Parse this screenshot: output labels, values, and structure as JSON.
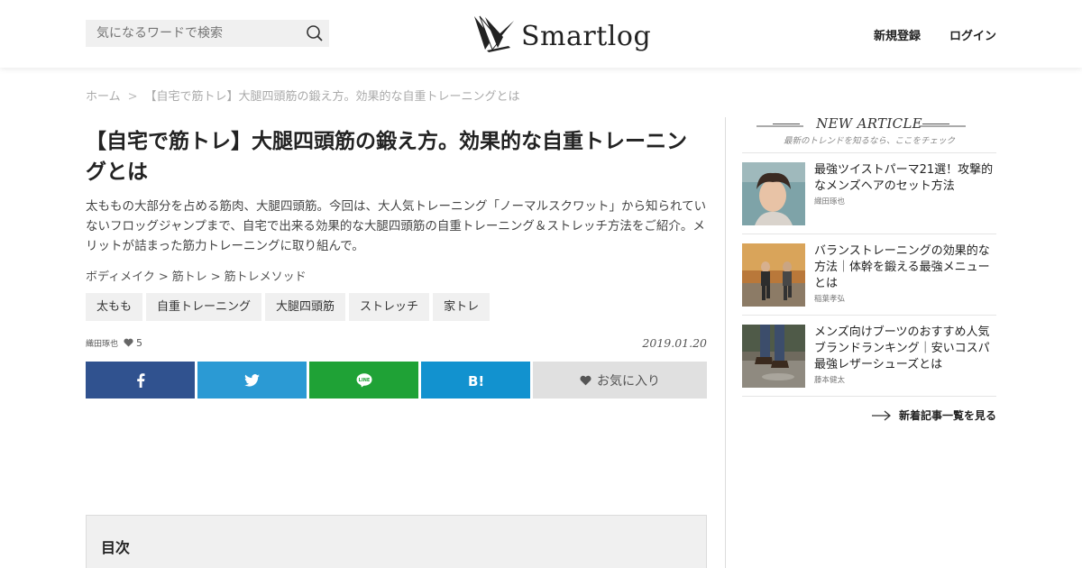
{
  "header": {
    "search_placeholder": "気になるワードで検索",
    "logo_text": "Smartlog",
    "signup_label": "新規登録",
    "login_label": "ログイン"
  },
  "breadcrumb": {
    "home": "ホーム",
    "separator": ">",
    "current": "【自宅で筋トレ】大腿四頭筋の鍛え方。効果的な自重トレーニングとは"
  },
  "article": {
    "title": "【自宅で筋トレ】大腿四頭筋の鍛え方。効果的な自重トレーニングとは",
    "lead": "太ももの大部分を占める筋肉、大腿四頭筋。今回は、大人気トレーニング「ノーマルスクワット」から知られていないフロッグジャンプまで、自宅で出来る効果的な大腿四頭筋の自重トレーニング＆ストレッチ方法をご紹介。メリットが詰まった筋力トレーニングに取り組んで。",
    "categories": [
      "ボディメイク",
      "筋トレ",
      "筋トレメソッド"
    ],
    "category_separator": ">",
    "tags": [
      "太もも",
      "自重トレーニング",
      "大腿四頭筋",
      "ストレッチ",
      "家トレ"
    ],
    "author": "織田琢也",
    "likes": "5",
    "date": "2019.01.20"
  },
  "share": {
    "favorite_label": "お気に入り"
  },
  "toc": {
    "title": "目次"
  },
  "sidebar": {
    "heading": "NEW ARTICLE",
    "subheading": "最新のトレンドを知るなら、ここをチェック",
    "items": [
      {
        "title": "最強ツイストパーマ21選！攻撃的なメンズヘアのセット方法",
        "author": "織田琢也"
      },
      {
        "title": "バランストレーニングの効果的な方法｜体幹を鍛える最強メニューとは",
        "author": "稲葉孝弘"
      },
      {
        "title": "メンズ向けブーツのおすすめ人気ブランドランキング｜安いコスパ最強レザーシューズとは",
        "author": "藤本健太"
      }
    ],
    "more_label": "新着記事一覧を見る"
  },
  "colors": {
    "facebook": "#30528f",
    "twitter": "#2b9ad4",
    "line": "#1fa236",
    "hatena": "#1292cf",
    "favorite": "#e0e0e0"
  }
}
